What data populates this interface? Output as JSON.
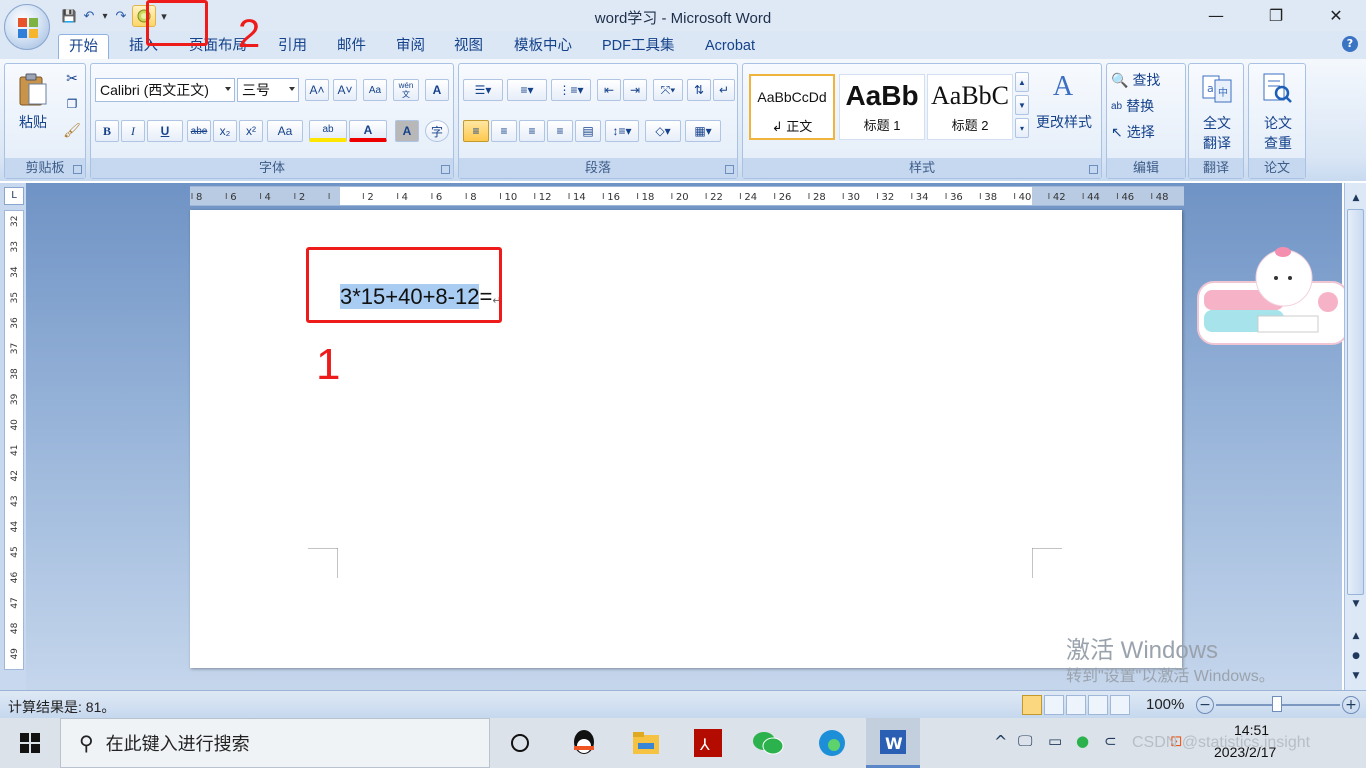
{
  "window": {
    "title": "word学习 - Microsoft Word",
    "minimize": "—",
    "restore": "❐",
    "close": "✕"
  },
  "qat": {
    "save": "💾",
    "undo": "↶",
    "undo_arrow": "▾",
    "redo": "↷",
    "calc": "☺",
    "customize": "▾"
  },
  "tabs": [
    "开始",
    "插入",
    "页面布局",
    "引用",
    "邮件",
    "审阅",
    "视图",
    "模板中心",
    "PDF工具集",
    "Acrobat"
  ],
  "help": "?",
  "clipboard": {
    "paste_label": "粘贴",
    "group": "剪贴板"
  },
  "font": {
    "name": "Calibri (西文正文)",
    "size": "三号",
    "group": "字体",
    "buttons": {
      "grow": "A˄",
      "shrink": "A˅",
      "clear": "Aa",
      "phonetic": "wén 文",
      "border": "A",
      "bold": "B",
      "italic": "I",
      "underline": "U",
      "strike": "abe",
      "sub": "x₂",
      "sup": "x²",
      "case": "Aa",
      "highlight": "ab",
      "color": "A",
      "shade": "A",
      "enclose": "字"
    }
  },
  "paragraph": {
    "group": "段落"
  },
  "styles": {
    "group": "样式",
    "tiles": [
      {
        "sample": "AaBbCcDd",
        "label": "↲ 正文"
      },
      {
        "sample": "AaBb",
        "label": "标题 1"
      },
      {
        "sample": "AaBbC",
        "label": "标题 2"
      }
    ],
    "change_label": "更改样式"
  },
  "editing": {
    "group": "编辑",
    "find": "查找",
    "replace": "替换",
    "select": "选择"
  },
  "translate": {
    "group": "翻译",
    "label1": "全文",
    "label2": "翻译"
  },
  "paper": {
    "group": "论文",
    "label1": "论文",
    "label2": "查重"
  },
  "ruler": {
    "h_ticks": [
      "8",
      "6",
      "4",
      "2",
      "",
      "2",
      "4",
      "6",
      "8",
      "10",
      "12",
      "14",
      "16",
      "18",
      "20",
      "22",
      "24",
      "26",
      "28",
      "30",
      "32",
      "34",
      "36",
      "38",
      "40",
      "42",
      "44",
      "46",
      "48"
    ],
    "v_ticks": [
      "32",
      "33",
      "34",
      "35",
      "36",
      "37",
      "38",
      "39",
      "40",
      "41",
      "42",
      "43",
      "44",
      "45",
      "46",
      "47",
      "48",
      "49"
    ]
  },
  "document": {
    "selected_text": "3*15+40+8-12",
    "rest_text": "=",
    "para_mark": "↵"
  },
  "annotations": {
    "label1": "1",
    "label2": "2"
  },
  "statusbar": {
    "message": "计算结果是: 81。",
    "zoom": "100%",
    "zoom_minus": "−",
    "zoom_plus": "+"
  },
  "taskbar": {
    "search_placeholder": "在此键入进行搜索",
    "time": "14:51",
    "date": "2023/2/17"
  },
  "watermark": {
    "line1": "激活 Windows",
    "line2": "转到\"设置\"以激活 Windows。",
    "csdn": "CSDN @statistics.insight"
  },
  "colors": {
    "accent": "#15428b",
    "annotation_red": "#ee1b1b",
    "selection": "#a9cdf2"
  }
}
